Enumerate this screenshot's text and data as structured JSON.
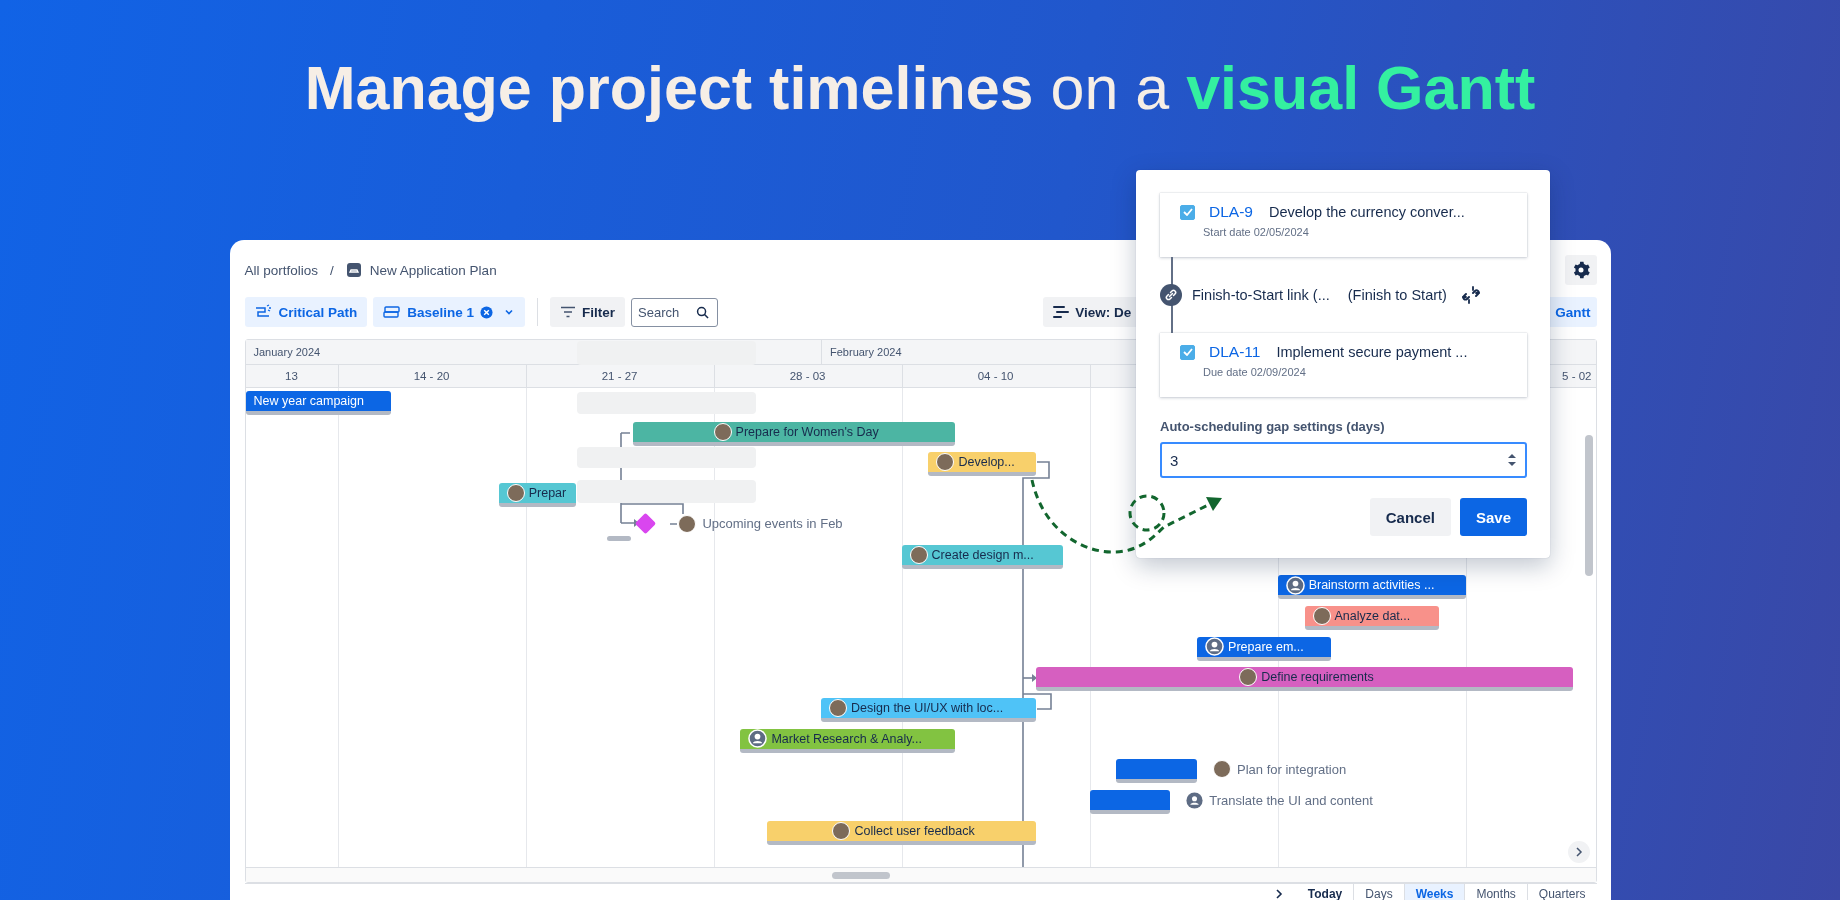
{
  "headline": [
    {
      "text": "Manage project timelines",
      "kind": "strong"
    },
    {
      "text": "on a",
      "kind": "light"
    },
    {
      "text": "visual Gantt",
      "kind": "accent"
    }
  ],
  "breadcrumb": {
    "root": "All portfolios",
    "separator": "/",
    "current": "New Application Plan"
  },
  "toolbar": {
    "critical_path": "Critical Path",
    "baseline": "Baseline 1",
    "filter": "Filter",
    "search": {
      "placeholder": "Search"
    },
    "view": "View: De",
    "gantt": "Gantt"
  },
  "timeline": {
    "months": [
      "January 2024",
      "February 2024"
    ],
    "weeks": [
      "13",
      "14 - 20",
      "21 - 27",
      "28 - 03",
      "04 - 10",
      "5 - 02"
    ],
    "rows": [
      {
        "kind": "bar",
        "label": "New year campaign",
        "color": "#0c66e4"
      },
      {
        "kind": "bar",
        "label": "Prepare for Women's Day",
        "color": "#4cb5a3",
        "avatar": {
          "kind": "photo"
        }
      },
      {
        "kind": "bar",
        "label": "Develop...",
        "color": "#f8d06b",
        "avatar": {
          "kind": "photo"
        }
      },
      {
        "kind": "bar",
        "label": "Prepar",
        "color": "#56c7d3",
        "avatar": {
          "kind": "photo"
        }
      },
      {
        "kind": "milestone",
        "label": "Upcoming events in Feb",
        "color": "#d946ef",
        "avatar": {
          "kind": "photo"
        }
      },
      {
        "kind": "bar",
        "label": "Create design m...",
        "color": "#56c7d3",
        "avatar": {
          "kind": "photo"
        }
      },
      {
        "kind": "bar",
        "label": "Brainstorm activities ...",
        "color": "#0c66e4",
        "avatar": {
          "kind": "generic"
        }
      },
      {
        "kind": "bar",
        "label": "Analyze dat...",
        "color": "#f8918a",
        "avatar": {
          "kind": "photo"
        }
      },
      {
        "kind": "bar",
        "label": "Prepare em...",
        "color": "#0c66e4",
        "avatar": {
          "kind": "generic"
        }
      },
      {
        "kind": "bar",
        "label": "Define requirements",
        "color": "#d65fc0",
        "avatar": {
          "kind": "photo"
        }
      },
      {
        "kind": "bar",
        "label": "Design the UI/UX with loc...",
        "color": "#4fc3f7",
        "avatar": {
          "kind": "photo"
        }
      },
      {
        "kind": "bar",
        "label": "Market Research & Analy...",
        "color": "#82c341",
        "avatar": {
          "kind": "generic"
        }
      },
      {
        "kind": "external",
        "label": "Plan for integration",
        "color": "#0c66e4",
        "avatar": {
          "kind": "photo"
        }
      },
      {
        "kind": "external",
        "label": "Translate the UI and content",
        "color": "#0c66e4",
        "avatar": {
          "kind": "generic"
        }
      },
      {
        "kind": "bar",
        "label": "Collect user feedback",
        "color": "#f8d06b",
        "avatar": {
          "kind": "photo"
        }
      }
    ]
  },
  "popup": {
    "source": {
      "checked": true,
      "key": "DLA-9",
      "title": "Develop the currency conver...",
      "date": "Start date 02/05/2024"
    },
    "link": {
      "name": "Finish-to-Start link (...",
      "type": "(Finish to Start)"
    },
    "target": {
      "checked": true,
      "key": "DLA-11",
      "title": "Implement secure payment ...",
      "date": "Due date 02/09/2024"
    },
    "gap": {
      "label": "Auto-scheduling gap settings (days)",
      "value": "3"
    },
    "buttons": [
      {
        "label": "Cancel",
        "kind": "secondary"
      },
      {
        "label": "Save",
        "kind": "primary"
      }
    ]
  },
  "footer": {
    "tabs": [
      {
        "label": "Today",
        "kind": "action",
        "selected": false
      },
      {
        "label": "Days",
        "kind": "scale",
        "selected": false
      },
      {
        "label": "Weeks",
        "kind": "scale",
        "selected": true
      },
      {
        "label": "Months",
        "kind": "scale",
        "selected": false
      },
      {
        "label": "Quarters",
        "kind": "scale",
        "selected": false
      }
    ]
  }
}
